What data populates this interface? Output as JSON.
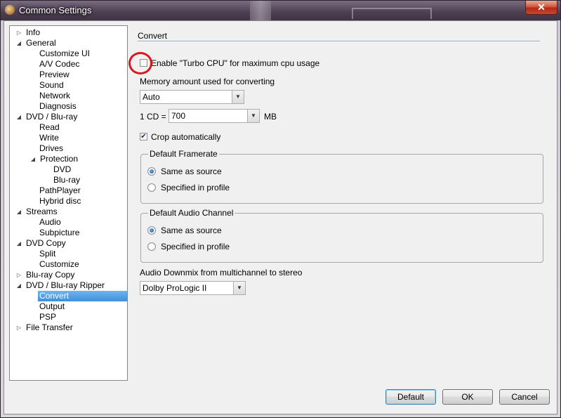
{
  "window": {
    "title": "Common Settings",
    "close_symbol": "✕"
  },
  "tree": {
    "items": [
      {
        "label": "Info",
        "level": 0,
        "glyph": "▷"
      },
      {
        "label": "General",
        "level": 0,
        "glyph": "◢"
      },
      {
        "label": "Customize UI",
        "level": 2,
        "glyph": ""
      },
      {
        "label": "A/V Codec",
        "level": 2,
        "glyph": ""
      },
      {
        "label": "Preview",
        "level": 2,
        "glyph": ""
      },
      {
        "label": "Sound",
        "level": 2,
        "glyph": ""
      },
      {
        "label": "Network",
        "level": 2,
        "glyph": ""
      },
      {
        "label": "Diagnosis",
        "level": 2,
        "glyph": ""
      },
      {
        "label": "DVD / Blu-ray",
        "level": 0,
        "glyph": "◢"
      },
      {
        "label": "Read",
        "level": 2,
        "glyph": ""
      },
      {
        "label": "Write",
        "level": 2,
        "glyph": ""
      },
      {
        "label": "Drives",
        "level": 2,
        "glyph": ""
      },
      {
        "label": "Protection",
        "level": 1,
        "glyph": "◢"
      },
      {
        "label": "DVD",
        "level": 3,
        "glyph": ""
      },
      {
        "label": "Blu-ray",
        "level": 3,
        "glyph": ""
      },
      {
        "label": "PathPlayer",
        "level": 2,
        "glyph": ""
      },
      {
        "label": "Hybrid disc",
        "level": 2,
        "glyph": ""
      },
      {
        "label": "Streams",
        "level": 0,
        "glyph": "◢"
      },
      {
        "label": "Audio",
        "level": 2,
        "glyph": ""
      },
      {
        "label": "Subpicture",
        "level": 2,
        "glyph": ""
      },
      {
        "label": "DVD Copy",
        "level": 0,
        "glyph": "◢"
      },
      {
        "label": "Split",
        "level": 2,
        "glyph": ""
      },
      {
        "label": "Customize",
        "level": 2,
        "glyph": ""
      },
      {
        "label": "Blu-ray Copy",
        "level": 0,
        "glyph": "▷"
      },
      {
        "label": "DVD / Blu-ray Ripper",
        "level": 0,
        "glyph": "◢"
      },
      {
        "label": "Convert",
        "level": 2,
        "glyph": "",
        "selected": true
      },
      {
        "label": "Output",
        "level": 2,
        "glyph": ""
      },
      {
        "label": "PSP",
        "level": 2,
        "glyph": ""
      },
      {
        "label": "File Transfer",
        "level": 0,
        "glyph": "▷"
      }
    ]
  },
  "convert": {
    "section_title": "Convert",
    "turbo_cpu_label": "Enable \"Turbo CPU\" for maximum cpu usage",
    "turbo_cpu_checked": false,
    "memory_label": "Memory amount used for converting",
    "memory_value": "Auto",
    "cd_label": "1 CD =",
    "cd_value": "700",
    "cd_unit": "MB",
    "crop_label": "Crop automatically",
    "crop_checked": true,
    "framerate": {
      "legend": "Default Framerate",
      "option1": "Same as source",
      "option2": "Specified in profile",
      "selected": 1
    },
    "audio_channel": {
      "legend": "Default Audio Channel",
      "option1": "Same as source",
      "option2": "Specified in profile",
      "selected": 1
    },
    "downmix_label": "Audio Downmix from multichannel to stereo",
    "downmix_value": "Dolby ProLogic II"
  },
  "buttons": {
    "default": "Default",
    "ok": "OK",
    "cancel": "Cancel"
  },
  "colors": {
    "highlight_circle": "#d9181f",
    "selection": "#3d8fdd"
  },
  "icons": {
    "combo_arrow": "▼",
    "check_mark": "✔"
  }
}
